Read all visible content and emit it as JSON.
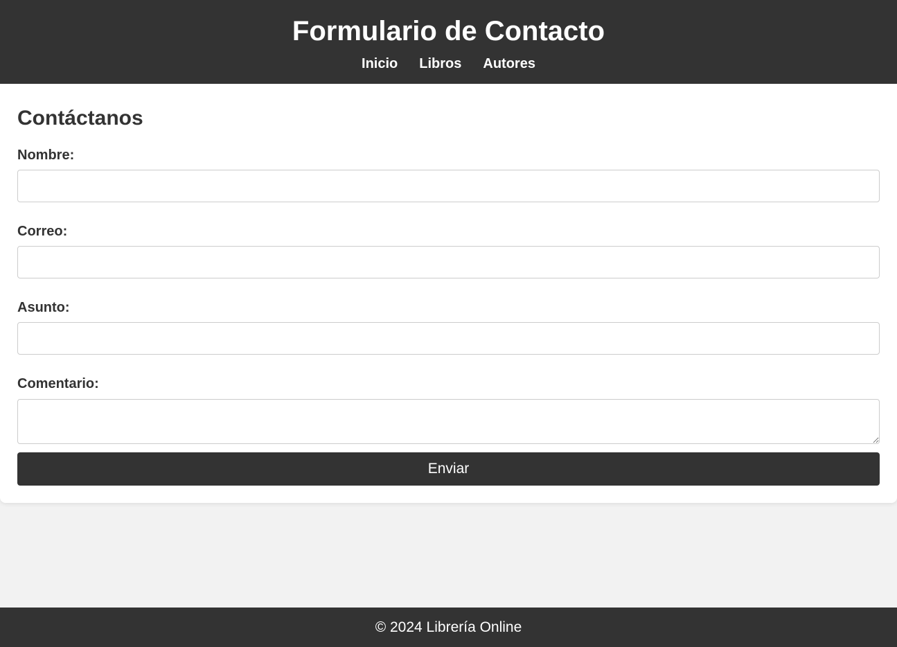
{
  "header": {
    "title": "Formulario de Contacto",
    "nav": [
      {
        "label": "Inicio"
      },
      {
        "label": "Libros"
      },
      {
        "label": "Autores"
      }
    ]
  },
  "form": {
    "heading": "Contáctanos",
    "fields": [
      {
        "label": "Nombre:",
        "value": "",
        "placeholder": ""
      },
      {
        "label": "Correo:",
        "value": "",
        "placeholder": ""
      },
      {
        "label": "Asunto:",
        "value": "",
        "placeholder": ""
      },
      {
        "label": "Comentario:",
        "value": "",
        "placeholder": ""
      }
    ],
    "submit_label": "Enviar"
  },
  "footer": {
    "text": "© 2024 Librería Online"
  },
  "colors": {
    "header_bg": "#333333",
    "page_bg": "#f2f2f2",
    "card_bg": "#ffffff",
    "text": "#333333",
    "button_bg": "#333333"
  }
}
